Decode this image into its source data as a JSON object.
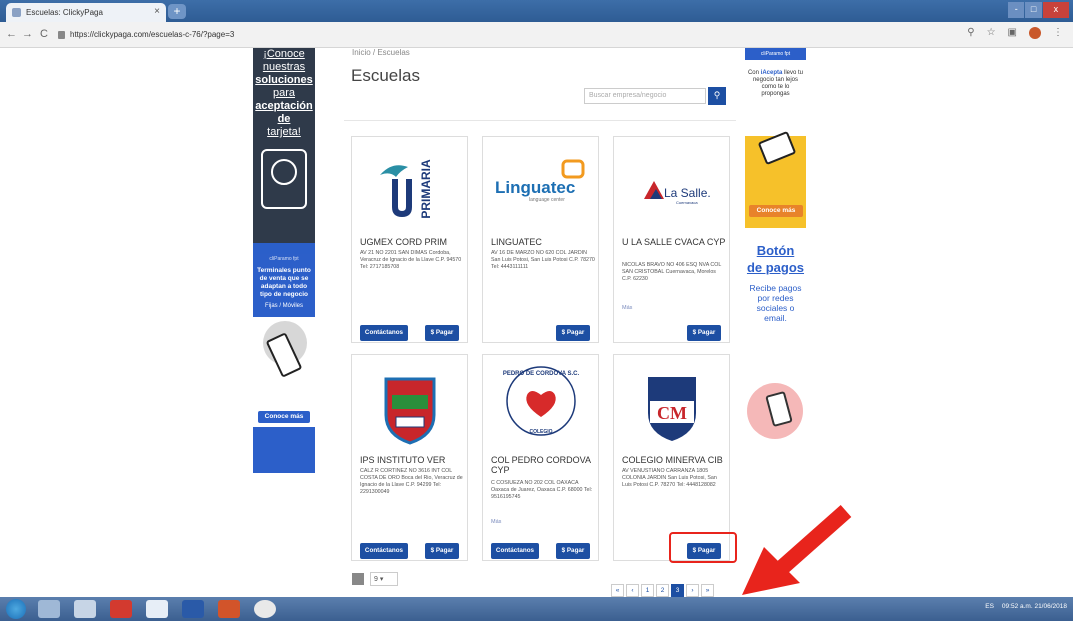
{
  "browser": {
    "tab_title": "Escuelas: ClickyPaga",
    "tab_close": "×",
    "new_tab": "+",
    "back": "←",
    "forward": "→",
    "reload": "C",
    "url": "https://clickypaga.com/escuelas-c-76/?page=3",
    "win_min": "-",
    "win_max": "□",
    "win_close": "x"
  },
  "page": {
    "breadcrumb": "Inicio / Escuelas",
    "title": "Escuelas",
    "search_placeholder": "Buscar empresa/negocio",
    "search_icon": "search-icon"
  },
  "ads": {
    "left_top_lines": [
      "¡Conoce",
      "nuestras",
      "soluciones",
      "para",
      "aceptación de",
      "tarjeta!"
    ],
    "left_mid_brand": "cliParamo  fpt",
    "left_mid_head": "Terminales punto de venta que se adaptan a todo tipo de negocio",
    "left_mid_sub": "Fijas / Móviles",
    "left_mid_cta": "Conoce más",
    "right_top_brand": "cliParamo  fpt",
    "right_top_msg_pre": "Con ",
    "right_top_msg_brand": "iAcepta",
    "right_top_msg_post": " llevo tu negocio tan lejos como te lo propongas",
    "right_top_cta": "Conoce más",
    "right_mid_title1": "Botón",
    "right_mid_title2": "de pagos",
    "right_mid_sub": "Recibe pagos por redes sociales o email."
  },
  "cards": [
    {
      "name": "UGMEX CORD PRIM",
      "info": "AV 21 NO 2201 SAN DIMAS Cordoba, Veracruz de Ignacio de la Llave C.P. 94570 Tel: 2717185708",
      "link": "",
      "contact": "Contáctanos",
      "pay": "$ Pagar",
      "logo_text": "PRIMARIA"
    },
    {
      "name": "LINGUATEC",
      "info": "AV 16 DE MARZO NO 620 COL JARDIN San Luis Potosi, San Luis Potosi C.P. 78270 Tel: 4443111111",
      "link": "",
      "contact": "",
      "pay": "$ Pagar",
      "logo_text": "Linguatec",
      "logo_sub": "language center"
    },
    {
      "name": "U LA SALLE CVACA CYP",
      "info": "NICOLAS BRAVO NO 406 ESQ NVA COL SAN CRISTOBAL Cuernavaca, Morelos C.P. 62230",
      "link": "Más",
      "contact": "",
      "pay": "$ Pagar",
      "logo_text": "La Salle.",
      "logo_sub": "Cuernavaca"
    },
    {
      "name": "IPS INSTITUTO VER",
      "info": "CALZ R CORTINEZ NO 3616 INT COL COSTA DE ORO Boca del Rio, Veracruz de Ignacio de la Llave C.P. 94299 Tel: 2291300049",
      "link": "",
      "contact": "Contáctanos",
      "pay": "$ Pagar",
      "logo_text": ""
    },
    {
      "name": "COL PEDRO CORDOVA CYP",
      "info": "C COSIUEZA NO 202 COL OAXACA Oaxaca de Juarez, Oaxaca C.P. 68000 Tel: 9516195745",
      "link": "Más",
      "contact": "Contáctanos",
      "pay": "$ Pagar",
      "logo_text": "PEDRO DE CORDOVA S.C.",
      "logo_sub": "COLEGIO"
    },
    {
      "name": "COLEGIO MINERVA CIB",
      "info": "AV VENUSTIANO CARRANZA 1805 COLONIA JARDIN San Luis Potosi, San Luis Potosi C.P. 78270 Tel: 4448128082",
      "link": "",
      "contact": "",
      "pay": "$ Pagar",
      "logo_text": "CM"
    }
  ],
  "pagination": {
    "per_page": "9",
    "first": "«",
    "prev": "‹",
    "pages": [
      "1",
      "2",
      "3"
    ],
    "current": "3",
    "next": "›",
    "last": "»"
  },
  "taskbar": {
    "lang": "ES",
    "time": "09:52 a.m.",
    "date": "21/06/2018"
  },
  "colors": {
    "brand_blue": "#1d4fa3",
    "highlight_red": "#e8241c"
  }
}
